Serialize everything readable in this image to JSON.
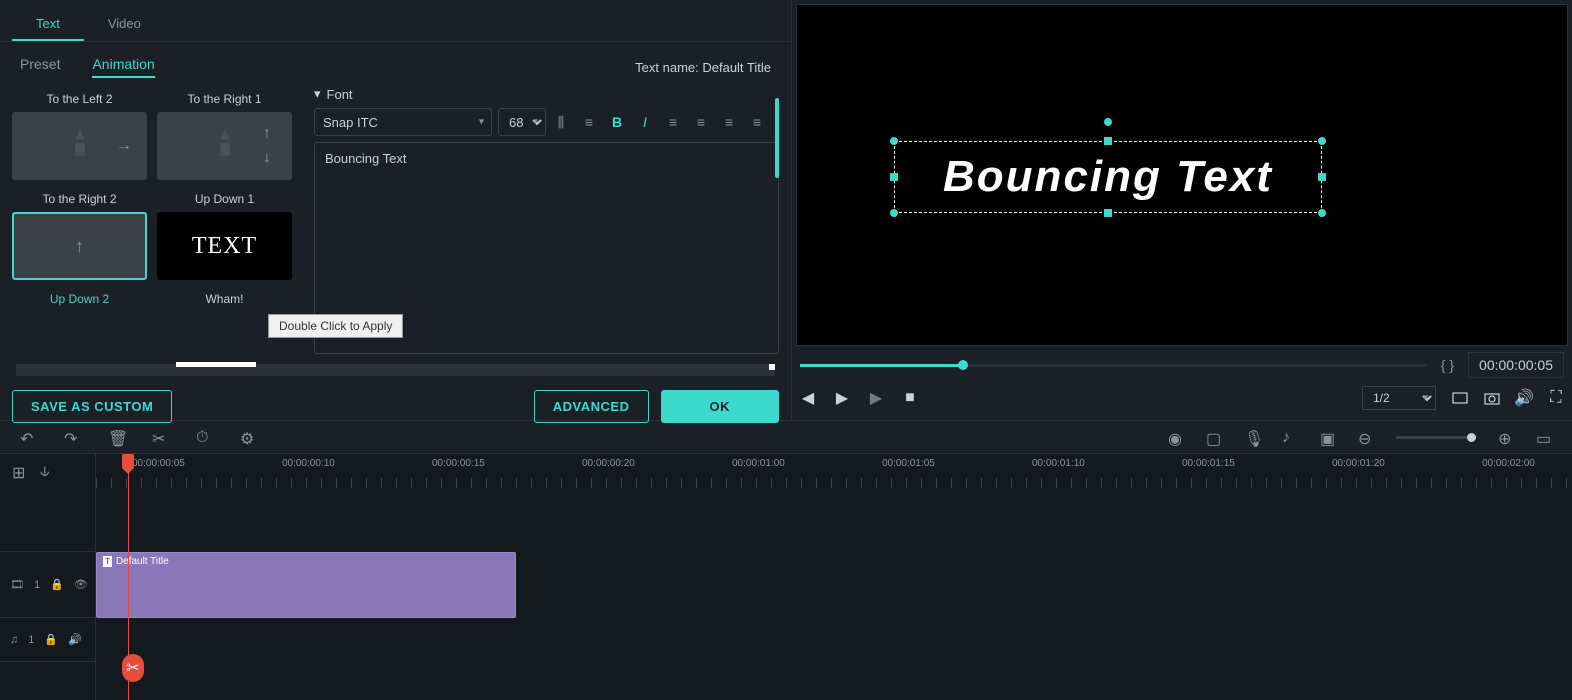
{
  "tabs": {
    "text": "Text",
    "video": "Video"
  },
  "subtabs": {
    "preset": "Preset",
    "animation": "Animation"
  },
  "text_name_label": "Text name: Default Title",
  "font": {
    "label": "Font",
    "family": "Snap ITC",
    "size": "68"
  },
  "text_content": "Bouncing Text",
  "presets": {
    "r1": {
      "a": "To the Left 2",
      "b": "To the Right 1"
    },
    "r2": {
      "a": "To the Right 2",
      "b": "Up Down 1"
    },
    "r3": {
      "a": "Up Down 2",
      "b": "Wham!"
    },
    "wham_text": "TEXT"
  },
  "tooltip": "Double Click to Apply",
  "buttons": {
    "save": "SAVE AS CUSTOM",
    "advanced": "ADVANCED",
    "ok": "OK"
  },
  "preview": {
    "canvas_text": "Bouncing Text",
    "timecode": "00:00:00:05",
    "view": "1/2",
    "brackets": "{    }"
  },
  "timeline": {
    "marks": [
      "00:00:00:05",
      "00:00:00:10",
      "00:00:00:15",
      "00:00:00:20",
      "00:00:01:00",
      "00:00:01:05",
      "00:00:01:10",
      "00:00:01:15",
      "00:00:01:20",
      "00:00:02:00"
    ],
    "clip_label": "Default Title",
    "track_video_num": "1",
    "track_audio_num": "1"
  }
}
